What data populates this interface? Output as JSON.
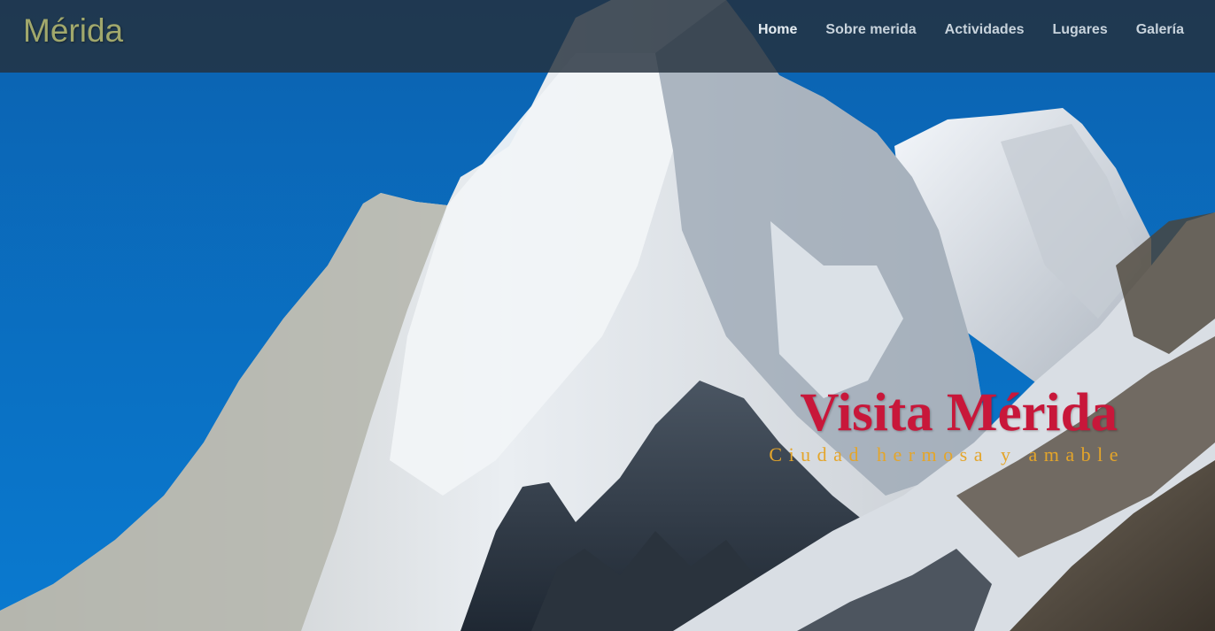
{
  "navbar": {
    "brand": "Mérida",
    "links": [
      {
        "label": "Home"
      },
      {
        "label": "Sobre merida"
      },
      {
        "label": "Actividades"
      },
      {
        "label": "Lugares"
      },
      {
        "label": "Galería"
      }
    ]
  },
  "hero": {
    "title": "Visita Mérida",
    "subtitle": "Ciudad hermosa y amable"
  },
  "colors": {
    "sky": "#0a6fc0",
    "brand": "#a1a86c",
    "title": "#c8173a",
    "subtitle": "#e4a52a",
    "navbar_bg": "#23303c"
  }
}
